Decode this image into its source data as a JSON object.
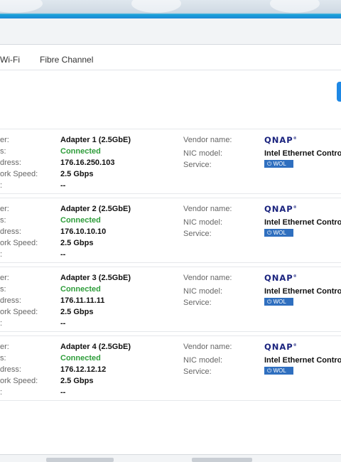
{
  "tabs": [
    "Wi-Fi",
    "Fibre Channel"
  ],
  "labels": {
    "adapter": "er:",
    "status": "s:",
    "ip": "dress:",
    "speed": "ork Speed:",
    "extra": ":",
    "vendor": "Vendor name:",
    "nic": "NIC model:",
    "service": "Service:"
  },
  "logo": "QNAP",
  "adapters": [
    {
      "name": "Adapter 1 (2.5GbE)",
      "status": "Connected",
      "ip": "176.16.250.103",
      "speed": "2.5 Gbps",
      "extra": "--",
      "nic_model": "Intel Ethernet Control",
      "service": "WOL"
    },
    {
      "name": "Adapter 2 (2.5GbE)",
      "status": "Connected",
      "ip": "176.10.10.10",
      "speed": "2.5 Gbps",
      "extra": "--",
      "nic_model": "Intel Ethernet Control",
      "service": "WOL"
    },
    {
      "name": "Adapter 3 (2.5GbE)",
      "status": "Connected",
      "ip": "176.11.11.11",
      "speed": "2.5 Gbps",
      "extra": "--",
      "nic_model": "Intel Ethernet Control",
      "service": "WOL"
    },
    {
      "name": "Adapter 4 (2.5GbE)",
      "status": "Connected",
      "ip": "176.12.12.12",
      "speed": "2.5 Gbps",
      "extra": "--",
      "nic_model": "Intel Ethernet Control",
      "service": "WOL"
    }
  ]
}
